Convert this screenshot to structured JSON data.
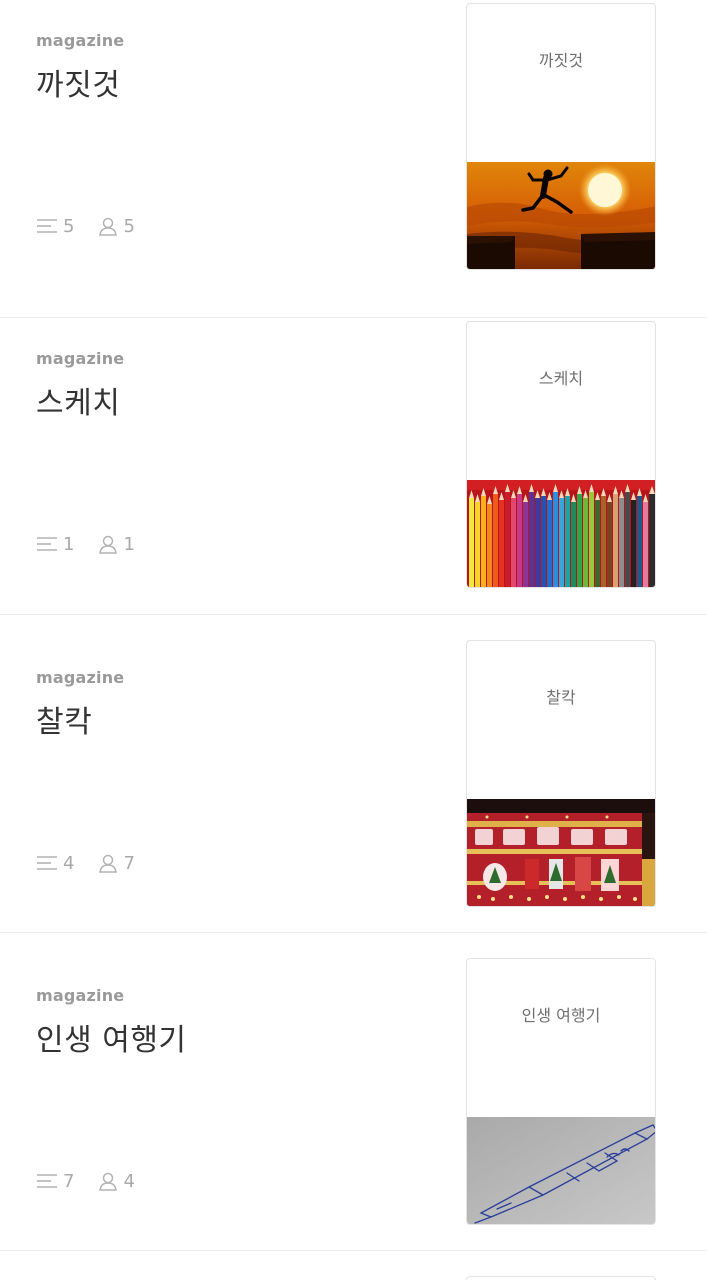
{
  "magazines": [
    {
      "label": "magazine",
      "title": "까짓것",
      "posts": "5",
      "subscribers": "5",
      "cover_title": "까짓것",
      "cover_image": "sunset-jump-photo"
    },
    {
      "label": "magazine",
      "title": "스케치",
      "posts": "1",
      "subscribers": "1",
      "cover_title": "스케치",
      "cover_image": "colored-pencils-photo"
    },
    {
      "label": "magazine",
      "title": "찰칵",
      "posts": "4",
      "subscribers": "7",
      "cover_title": "찰칵",
      "cover_image": "christmas-lights-building-photo"
    },
    {
      "label": "magazine",
      "title": "인생 여행기",
      "posts": "7",
      "subscribers": "4",
      "cover_title": "인생 여행기",
      "cover_image": "pen-sketch-photo"
    }
  ],
  "icons": {
    "posts": "list-icon",
    "subscribers": "person-icon"
  }
}
